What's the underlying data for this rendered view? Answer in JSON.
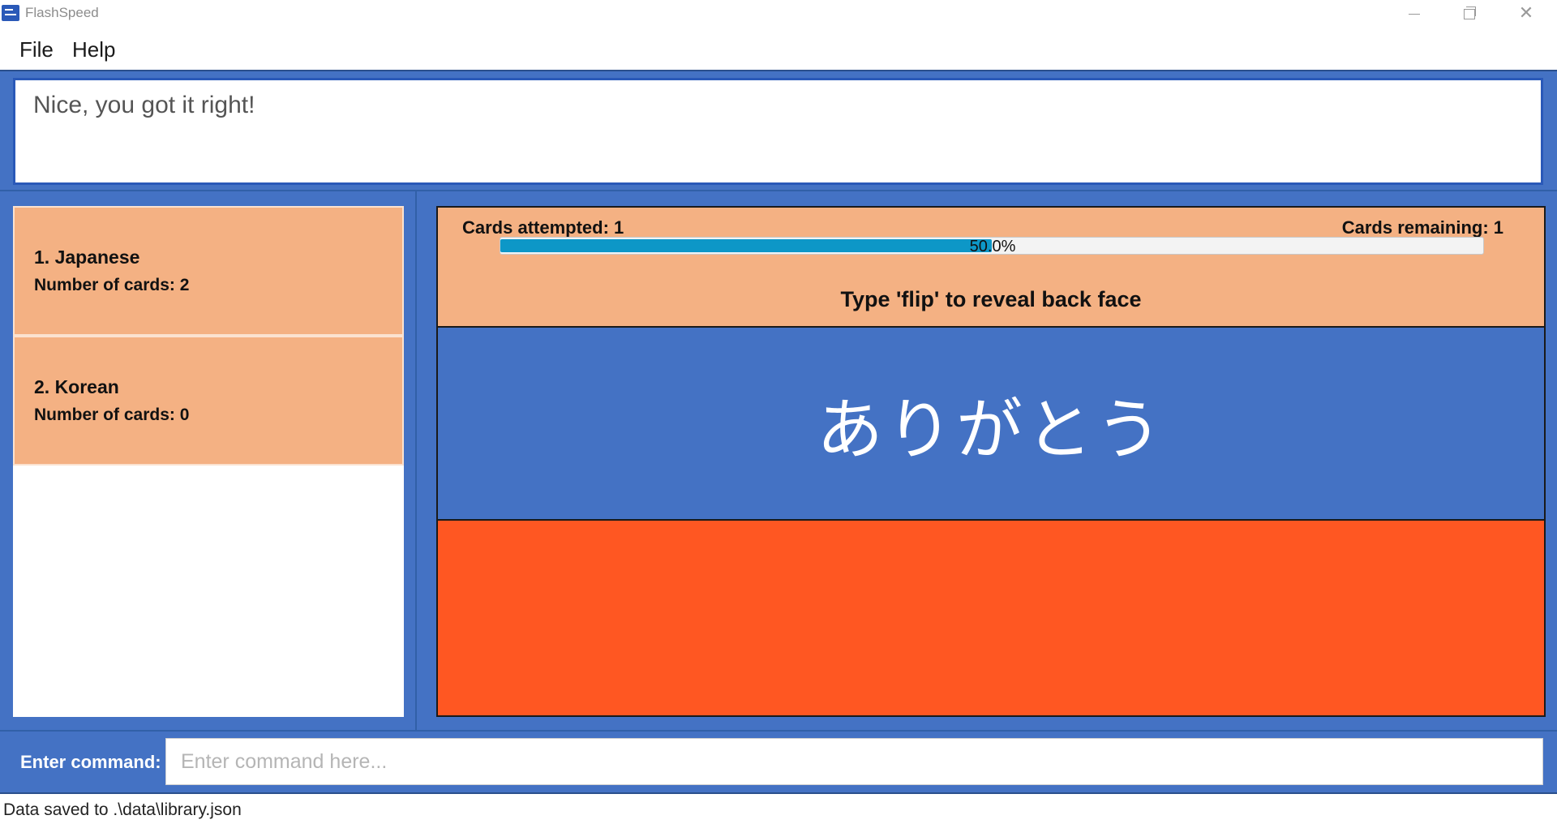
{
  "window": {
    "title": "FlashSpeed",
    "icons": {
      "app": "flashspeed-app-icon",
      "minimize": "minimize-icon",
      "maximize": "restore-icon",
      "close": "close-icon"
    },
    "close_glyph": "✕"
  },
  "menu": {
    "file_label": "File",
    "help_label": "Help"
  },
  "result_display": {
    "text": "Nice, you got it right!"
  },
  "decks": [
    {
      "title": "1.  Japanese",
      "count": "Number of cards: 2"
    },
    {
      "title": "2.  Korean",
      "count": "Number of cards: 0"
    }
  ],
  "review": {
    "attempted": "Cards attempted: 1",
    "remaining": "Cards remaining: 1",
    "progress": 0.5,
    "progress_label": "50.0%",
    "instruction": "Type 'flip' to reveal back face",
    "front_text": "ありがとう",
    "back_text": ""
  },
  "command": {
    "label": "Enter command:",
    "placeholder": "Enter command here...",
    "value": ""
  },
  "status": {
    "text": "Data saved to .\\data\\library.json"
  },
  "colors": {
    "frame_blue": "#4472c4",
    "deck_peach": "#f4b183",
    "back_face_orange": "#ff5722",
    "progress_fill": "#0d97c7"
  }
}
